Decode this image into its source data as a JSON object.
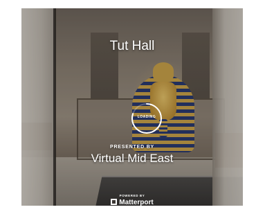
{
  "viewer": {
    "title": "Tut Hall",
    "loading_label": "LOADING",
    "presented_by_label": "PRESENTED BY",
    "presenter_name": "Virtual Mid East",
    "powered_by_label": "POWERED BY",
    "brand_name": "Matterport",
    "loading_progress": 0.8
  },
  "icons": {
    "loader": "loading-spinner-icon",
    "brand": "matterport-logo-icon"
  },
  "colors": {
    "overlay_text": "#ffffff"
  }
}
